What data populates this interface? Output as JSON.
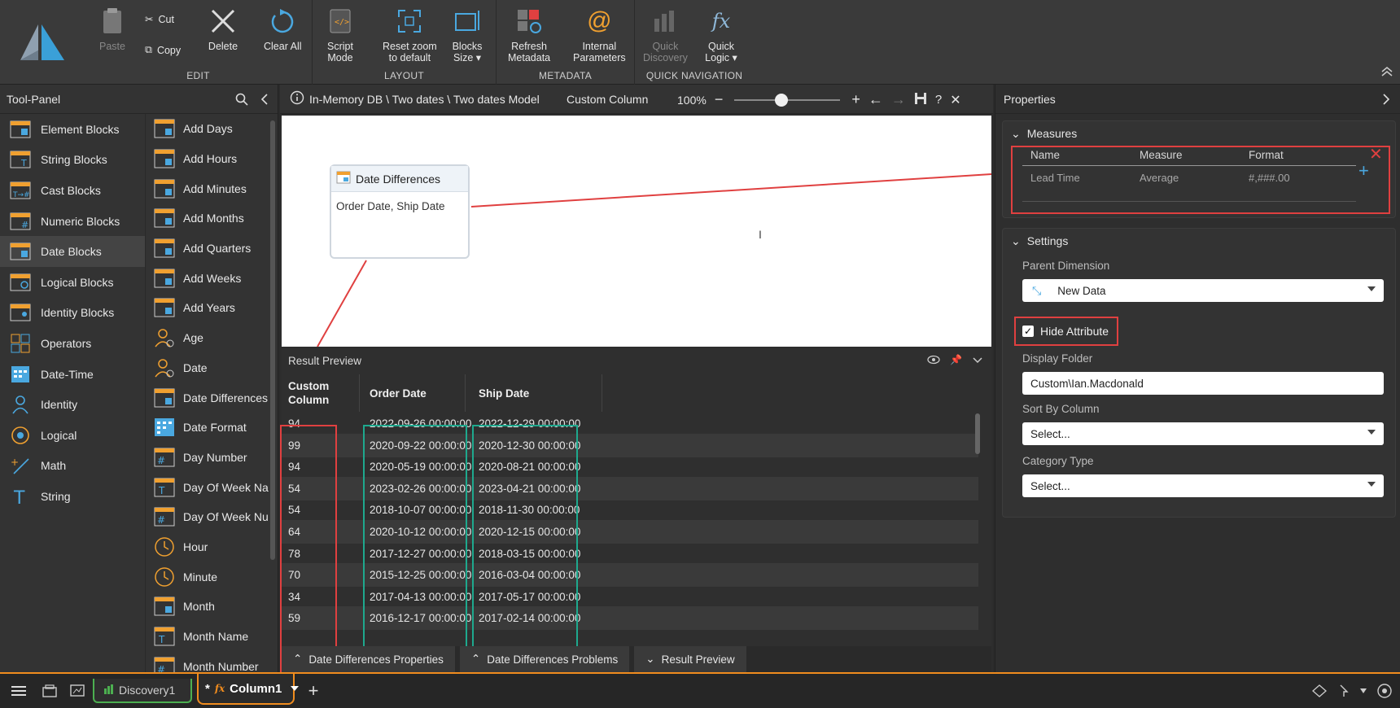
{
  "ribbon": {
    "edit": {
      "paste": "Paste",
      "cut": "Cut",
      "copy": "Copy",
      "delete": "Delete",
      "clear_all": "Clear All",
      "group": "EDIT"
    },
    "layout": {
      "script_mode_1": "Script",
      "script_mode_2": "Mode",
      "reset_zoom_1": "Reset zoom",
      "reset_zoom_2": "to default",
      "blocks_size_1": "Blocks",
      "blocks_size_2": "Size ▾",
      "group": "LAYOUT"
    },
    "metadata": {
      "refresh_1": "Refresh",
      "refresh_2": "Metadata",
      "internal_1": "Internal",
      "internal_2": "Parameters",
      "group": "METADATA"
    },
    "quicknav": {
      "discovery_1": "Quick",
      "discovery_2": "Discovery",
      "logic_1": "Quick",
      "logic_2": "Logic ▾",
      "group": "QUICK NAVIGATION"
    }
  },
  "toolpanel": {
    "title": "Tool-Panel",
    "categories": [
      {
        "label": "Element Blocks",
        "icon": "element-blocks-icon"
      },
      {
        "label": "String Blocks",
        "icon": "string-blocks-icon"
      },
      {
        "label": "Cast Blocks",
        "icon": "cast-blocks-icon"
      },
      {
        "label": "Numeric Blocks",
        "icon": "numeric-blocks-icon"
      },
      {
        "label": "Date Blocks",
        "icon": "date-blocks-icon"
      },
      {
        "label": "Logical Blocks",
        "icon": "logical-blocks-icon"
      },
      {
        "label": "Identity Blocks",
        "icon": "identity-blocks-icon"
      },
      {
        "label": "Operators",
        "icon": "operators-icon"
      },
      {
        "label": "Date-Time",
        "icon": "date-time-icon"
      },
      {
        "label": "Identity",
        "icon": "identity-icon"
      },
      {
        "label": "Logical",
        "icon": "logical-icon"
      },
      {
        "label": "Math",
        "icon": "math-icon"
      },
      {
        "label": "String",
        "icon": "string-icon"
      }
    ],
    "blocks": [
      "Add Days",
      "Add Hours",
      "Add Minutes",
      "Add Months",
      "Add Quarters",
      "Add Weeks",
      "Add Years",
      "Age",
      "Date",
      "Date Differences",
      "Date Format",
      "Day Number",
      "Day Of Week Na...",
      "Day Of Week Nu...",
      "Hour",
      "Minute",
      "Month",
      "Month Name",
      "Month Number"
    ]
  },
  "center": {
    "breadcrumb": "In-Memory DB \\ Two dates \\ Two dates Model",
    "tab_name": "Custom Column",
    "zoom": "100%",
    "node": {
      "title": "Date Differences",
      "body": "Order Date, Ship Date"
    },
    "result_preview": {
      "title": "Result Preview",
      "columns": [
        "Custom Column",
        "Order Date",
        "Ship Date"
      ],
      "rows": [
        [
          "94",
          "2022-09-26 00:00:00",
          "2022-12-29 00:00:00"
        ],
        [
          "99",
          "2020-09-22 00:00:00",
          "2020-12-30 00:00:00"
        ],
        [
          "94",
          "2020-05-19 00:00:00",
          "2020-08-21 00:00:00"
        ],
        [
          "54",
          "2023-02-26 00:00:00",
          "2023-04-21 00:00:00"
        ],
        [
          "54",
          "2018-10-07 00:00:00",
          "2018-11-30 00:00:00"
        ],
        [
          "64",
          "2020-10-12 00:00:00",
          "2020-12-15 00:00:00"
        ],
        [
          "78",
          "2017-12-27 00:00:00",
          "2018-03-15 00:00:00"
        ],
        [
          "70",
          "2015-12-25 00:00:00",
          "2016-03-04 00:00:00"
        ],
        [
          "34",
          "2017-04-13 00:00:00",
          "2017-05-17 00:00:00"
        ],
        [
          "59",
          "2016-12-17 00:00:00",
          "2017-02-14 00:00:00"
        ]
      ]
    },
    "bottom_tabs": [
      "Date Differences Properties",
      "Date Differences Problems",
      "Result Preview"
    ]
  },
  "props": {
    "title": "Properties",
    "measures": {
      "title": "Measures",
      "headers": [
        "Name",
        "Measure",
        "Format"
      ],
      "row": [
        "Lead Time",
        "Average",
        "#,###.00"
      ]
    },
    "settings": {
      "title": "Settings",
      "parent_dimension_label": "Parent Dimension",
      "parent_dimension_value": "New Data",
      "hide_attribute": "Hide Attribute",
      "display_folder_label": "Display Folder",
      "display_folder_value": "Custom\\Ian.Macdonald",
      "sort_by_label": "Sort By Column",
      "sort_by_value": "Select...",
      "category_label": "Category Type",
      "category_value": "Select..."
    }
  },
  "taskbar": {
    "tab1": "Discovery1",
    "tab2": "* ",
    "tab2_name": "Column1"
  },
  "colors": {
    "accent_orange": "#f08c1e",
    "highlight_red": "#e04040",
    "highlight_teal": "#1ea98e",
    "discovery_green": "#4caf50"
  }
}
